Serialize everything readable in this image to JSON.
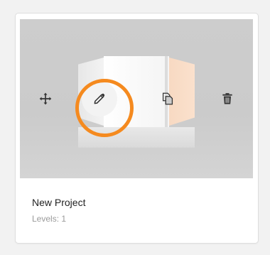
{
  "project": {
    "name": "New Project",
    "levels_text": "Levels: 1"
  },
  "actions": {
    "move_icon": "move-arrows-icon",
    "edit_icon": "pencil-icon",
    "copy_icon": "copy-icon",
    "delete_icon": "trash-icon"
  },
  "colors": {
    "highlight": "#f58a1f",
    "thumbnail_bg": "#cccccc",
    "card_bg": "#ffffff"
  }
}
